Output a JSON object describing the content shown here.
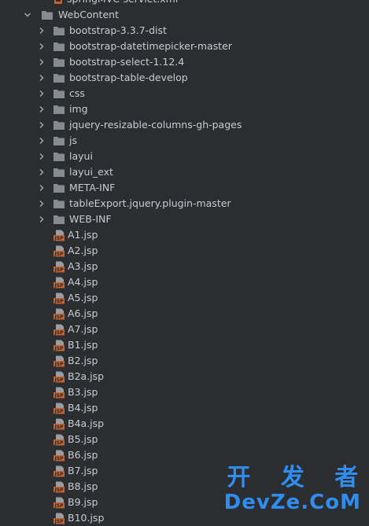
{
  "tree": {
    "partial_top": "springMVC-servlet.xml",
    "root": {
      "label": "WebContent"
    },
    "folders": [
      "bootstrap-3.3.7-dist",
      "bootstrap-datetimepicker-master",
      "bootstrap-select-1.12.4",
      "bootstrap-table-develop",
      "css",
      "img",
      "jquery-resizable-columns-gh-pages",
      "js",
      "layui",
      "layui_ext",
      "META-INF",
      "tableExport.jquery.plugin-master",
      "WEB-INF"
    ],
    "files": [
      "A1.jsp",
      "A2.jsp",
      "A3.jsp",
      "A4.jsp",
      "A5.jsp",
      "A6.jsp",
      "A7.jsp",
      "B1.jsp",
      "B2.jsp",
      "B2a.jsp",
      "B3.jsp",
      "B4.jsp",
      "B4a.jsp",
      "B5.jsp",
      "B6.jsp",
      "B7.jsp",
      "B8.jsp",
      "B9.jsp",
      "B10.jsp"
    ],
    "icons": {
      "folder": "folder-icon",
      "jsp": "jsp-file-icon",
      "xml": "xml-file-icon",
      "chevron_right": "chevron-right-icon",
      "chevron_down": "chevron-down-icon"
    }
  },
  "watermark": {
    "top": "开 发 者",
    "bottom": "DevZe.CoM"
  },
  "colors": {
    "background": "#2b2d30",
    "text": "#c9cdd3",
    "folder": "#868a91",
    "jsp_icon": "#c2622e",
    "watermark": "#2f8df0"
  }
}
